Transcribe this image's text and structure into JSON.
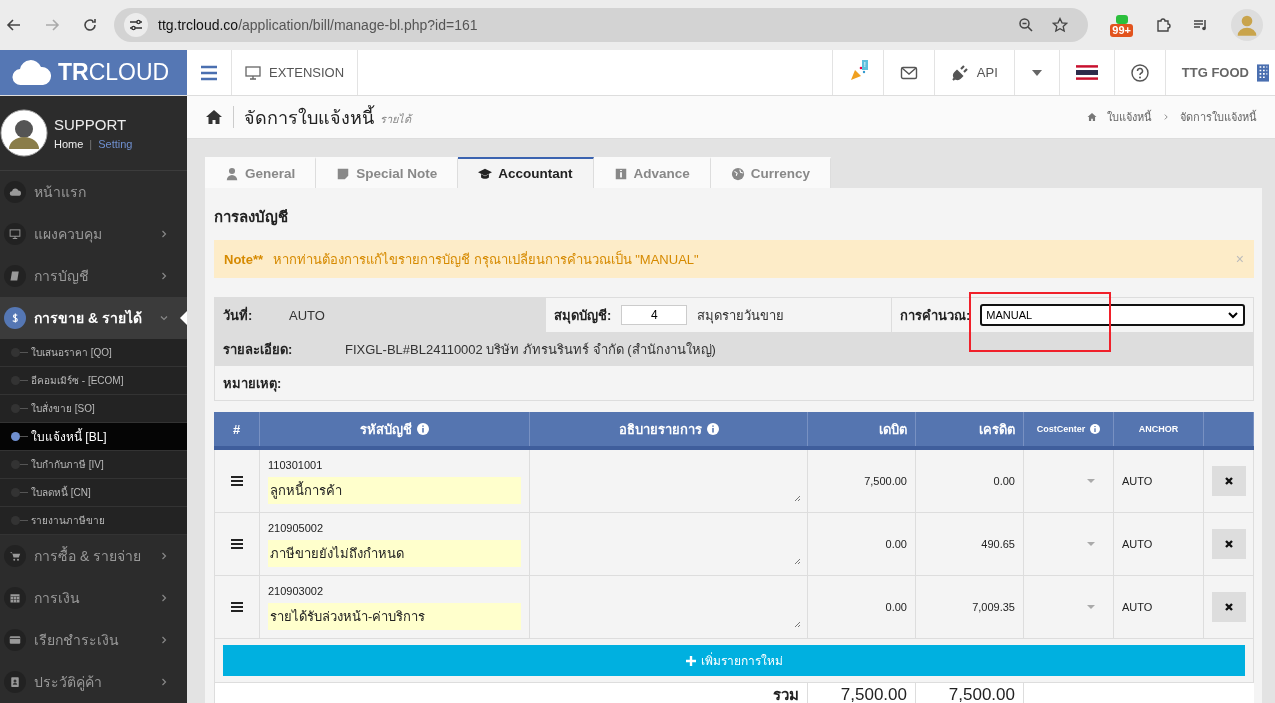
{
  "browser": {
    "url_host": "ttg.trcloud.co",
    "url_path": "/application/bill/manage-bl.php?id=161",
    "extension_badge": "99+"
  },
  "topbar": {
    "logo_bold": "TR",
    "logo_rest": "CLOUD",
    "extension": "EXTENSION",
    "notification_badge": "!",
    "api": "API",
    "company": "TTG FOOD"
  },
  "profile": {
    "name": "SUPPORT",
    "home": "Home",
    "separator": "|",
    "setting": "Setting"
  },
  "sidebar": {
    "items": [
      {
        "label": "หน้าแรก",
        "kind": "cloud",
        "has_children": false,
        "expanded": false
      },
      {
        "label": "แผงควบคุม",
        "kind": "monitor",
        "has_children": true,
        "expanded": false
      },
      {
        "label": "การบัญชี",
        "kind": "book",
        "has_children": true,
        "expanded": false
      },
      {
        "label": "การขาย & รายได้",
        "kind": "dollar",
        "has_children": true,
        "expanded": true,
        "children": [
          {
            "label": "ใบเสนอราคา [QO]",
            "selected": false
          },
          {
            "label": "อีคอมเมิร์ซ - [ECOM]",
            "selected": false
          },
          {
            "label": "ใบสั่งขาย [SO]",
            "selected": false
          },
          {
            "label": "ใบแจ้งหนี้ [BL]",
            "selected": true
          },
          {
            "label": "ใบกำกับภาษี [IV]",
            "selected": false
          },
          {
            "label": "ใบลดหนี้ [CN]",
            "selected": false
          },
          {
            "label": "รายงานภาษีขาย",
            "selected": false
          }
        ]
      },
      {
        "label": "การซื้อ & รายจ่าย",
        "kind": "cart",
        "has_children": true,
        "expanded": false
      },
      {
        "label": "การเงิน",
        "kind": "calendar",
        "has_children": true,
        "expanded": false
      },
      {
        "label": "เรียกชำระเงิน",
        "kind": "card",
        "has_children": true,
        "expanded": false
      },
      {
        "label": "ประวัติคู่ค้า",
        "kind": "contact",
        "has_children": true,
        "expanded": false
      }
    ]
  },
  "page_header": {
    "title": "จัดการใบแจ้งหนี้",
    "subtitle": "รายได้",
    "breadcrumb": [
      "ใบแจ้งหนี้",
      "จัดการใบแจ้งหนี้"
    ]
  },
  "tabs": [
    {
      "label": "General",
      "kind": "user",
      "selected": false
    },
    {
      "label": "Special Note",
      "kind": "note",
      "selected": false
    },
    {
      "label": "Accountant",
      "kind": "cap",
      "selected": true
    },
    {
      "label": "Advance",
      "kind": "info",
      "selected": false
    },
    {
      "label": "Currency",
      "kind": "globe",
      "selected": false
    }
  ],
  "section_title": "การลงบัญชี",
  "note": {
    "label": "Note**",
    "text": "หากท่านต้องการแก้ไขรายการบัญชี กรุณาเปลี่ยนการคำนวณเป็น \"MANUAL\"",
    "close": "×"
  },
  "info": {
    "date_label": "วันที่:",
    "date_value": "AUTO",
    "journal_label": "สมุดบัญชี:",
    "journal_value": "4",
    "journal_name": "สมุดรายวันขาย",
    "calc_label": "การคำนวณ:",
    "calc_value": "MANUAL",
    "detail_label": "รายละเอียด:",
    "detail_value": "FIXGL-BL#BL24110002  บริษัท ภัทรนรินทร์  จำกัด  (สำนักงานใหญ่)",
    "remark_label": "หมายเหตุ:"
  },
  "table": {
    "columns": [
      "#",
      "รหัสบัญชี",
      "อธิบายรายการ",
      "เดบิต",
      "เครดิต",
      "CostCenter",
      "ANCHOR"
    ],
    "rows": [
      {
        "code": "110301001",
        "name": "ลูกหนี้การค้า",
        "debit": "7,500.00",
        "credit": "0.00",
        "anchor": "AUTO"
      },
      {
        "code": "210905002",
        "name": "ภาษีขายยังไม่ถึงกำหนด",
        "debit": "0.00",
        "credit": "490.65",
        "anchor": "AUTO"
      },
      {
        "code": "210903002",
        "name": "รายได้รับล่วงหน้า-ค่าบริการ",
        "debit": "0.00",
        "credit": "7,009.35",
        "anchor": "AUTO"
      }
    ],
    "add_button": "เพิ่มรายการใหม่",
    "total_label": "รวม",
    "total_debit": "7,500.00",
    "total_credit": "7,500.00"
  }
}
